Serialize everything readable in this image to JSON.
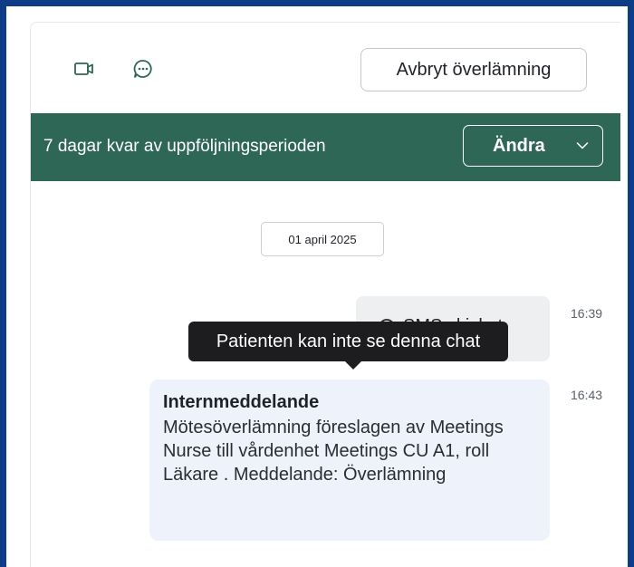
{
  "toolbar": {
    "icons": [
      "video-icon",
      "chat-icon"
    ],
    "cancel_label": "Avbryt överlämning"
  },
  "banner": {
    "text": "7 dagar kvar av uppföljningsperioden",
    "change_label": "Ändra",
    "background": "#2f6757"
  },
  "chat": {
    "date": "01 april 2025",
    "messages": [
      {
        "type": "sms",
        "text": "SMS skickat",
        "time": "16:39"
      },
      {
        "type": "internal",
        "title": "Internmeddelande",
        "body": "Mötesöverlämning föreslagen av Meetings Nurse till vårdenhet Meetings CU A1, roll Läkare . Meddelande: Överlämning",
        "time": "16:43"
      }
    ],
    "tooltip": "Patienten kan inte se denna chat"
  },
  "colors": {
    "frame": "#0d3d86",
    "accent": "#2f6757",
    "internal_bubble": "#eef2fb",
    "tooltip": "#1d1d1f"
  }
}
